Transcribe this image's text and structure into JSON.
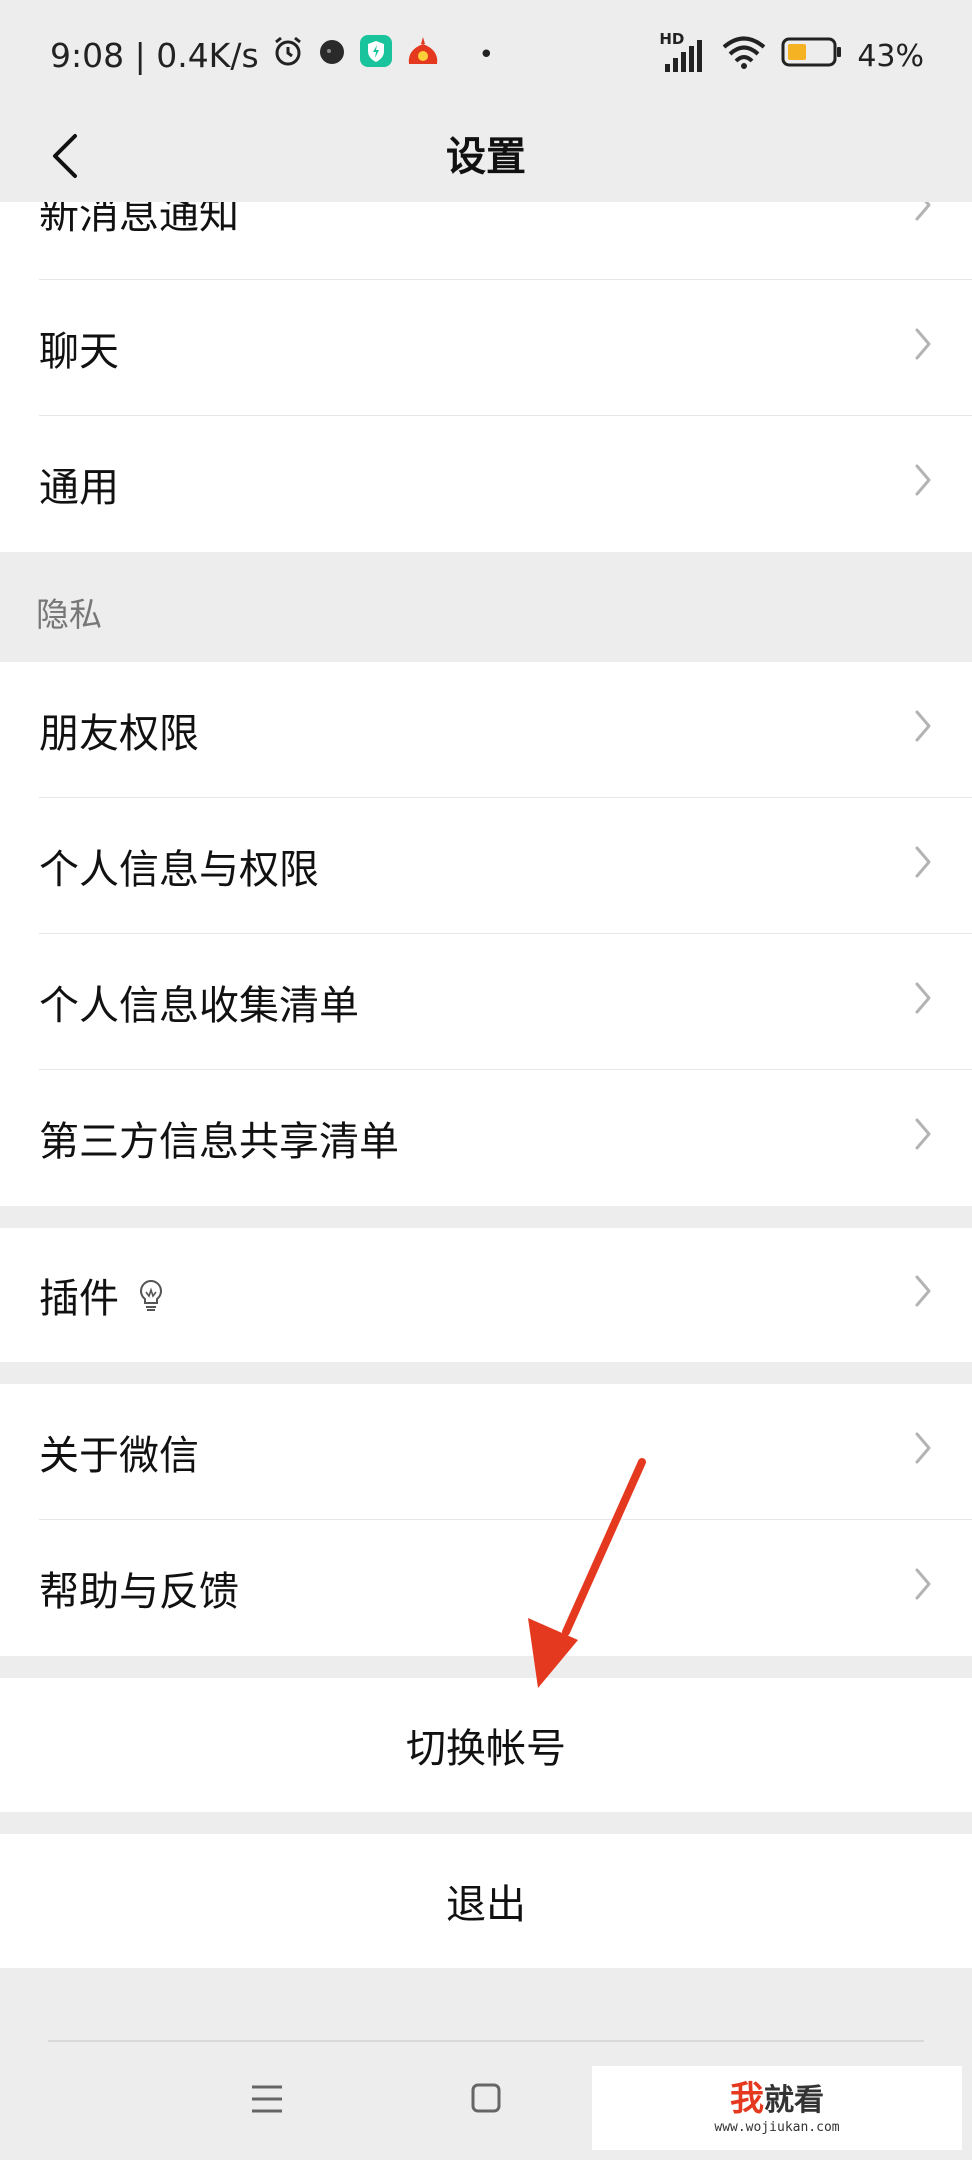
{
  "status_bar": {
    "time": "9:08 | 0.4K/s",
    "network": "HD",
    "battery": "43%",
    "battery_level": 0.43
  },
  "nav": {
    "title": "设置"
  },
  "group1": [
    {
      "label": "新消息通知"
    },
    {
      "label": "聊天"
    },
    {
      "label": "通用"
    }
  ],
  "privacy": {
    "section_label": "隐私",
    "items": [
      {
        "label": "朋友权限"
      },
      {
        "label": "个人信息与权限"
      },
      {
        "label": "个人信息收集清单"
      },
      {
        "label": "第三方信息共享清单"
      }
    ]
  },
  "plugins": {
    "label": "插件"
  },
  "about": [
    {
      "label": "关于微信"
    },
    {
      "label": "帮助与反馈"
    }
  ],
  "switch_account": "切换帐号",
  "logout": "退出",
  "watermark": {
    "brand": "我就看",
    "brand_accent": "我",
    "brand_rest": "就看",
    "url": "www.wojiukan.com"
  },
  "colors": {
    "accent_red": "#e5391f",
    "battery_fill": "#f5b324",
    "shield_green": "#19c39b"
  }
}
